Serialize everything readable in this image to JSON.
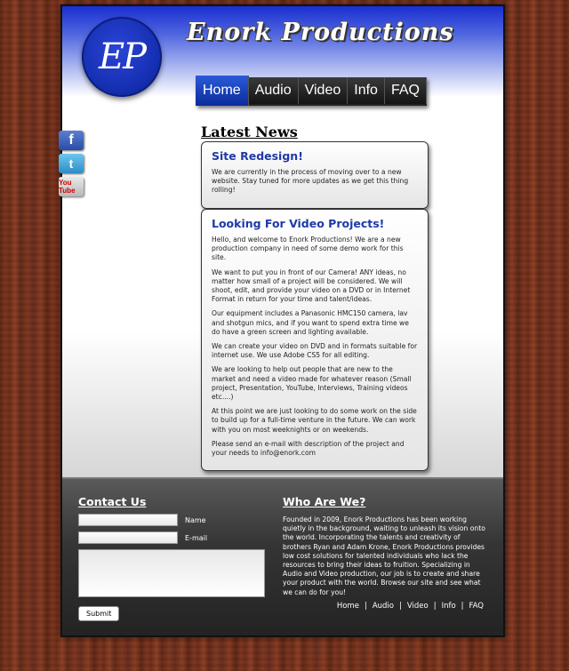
{
  "brand": {
    "logo_text": "EP",
    "title": "Enork Productions"
  },
  "nav": [
    {
      "label": "Home",
      "active": true
    },
    {
      "label": "Audio",
      "active": false
    },
    {
      "label": "Video",
      "active": false
    },
    {
      "label": "Info",
      "active": false
    },
    {
      "label": "FAQ",
      "active": false
    }
  ],
  "social": {
    "facebook": "f",
    "twitter": "t",
    "youtube": "You Tube"
  },
  "news": {
    "heading": "Latest News",
    "posts": [
      {
        "title": "Site Redesign!",
        "paragraphs": [
          "We are currently in the process of moving over to a new website. Stay tuned for more updates as we get this thing rolling!"
        ]
      },
      {
        "title": "Looking For Video Projects!",
        "paragraphs": [
          "Hello, and welcome to Enork Productions! We are a new production company in need of some demo work for this site.",
          "We want to put you in front of our Camera! ANY ideas, no matter how small of a project will be considered. We will shoot, edit, and provide your video on a DVD or in Internet Format in return for your time and talent/ideas.",
          "Our equipment includes a Panasonic HMC150 camera, lav and shotgun mics, and if you want to spend extra time we do have a green screen and lighting available.",
          "We can create your video on DVD and in formats suitable for internet use. We use Adobe CS5 for all editing.",
          "We are looking to help out people that are new to the market and need a video made for whatever reason (Small project, Presentation, YouTube, Interviews, Training videos etc....)",
          "At this point we are just looking to do some work on the side to build up for a full-time venture in the future. We can work with you on most weeknights or on weekends.",
          "Please send an e-mail with description of the project and your needs to info@enork.com"
        ]
      }
    ]
  },
  "contact": {
    "heading": "Contact Us",
    "name_label": "Name",
    "email_label": "E-mail",
    "name_value": "",
    "email_value": "",
    "message_value": "",
    "submit_label": "Submit"
  },
  "about": {
    "heading": "Who Are We?",
    "text": "Founded in 2009, Enork Productions has been working quietly in the background, waiting to unleash its vision onto the world. Incorporating the talents and creativity of brothers Ryan and Adam Krone, Enork Productions provides low cost solutions for talented individuals who lack the resources to bring their ideas to fruition. Specializing in Audio and Video production, our job is to create and share your product with the world. Browse our site and see what we can do for you!"
  },
  "footer_nav": [
    "Home",
    "Audio",
    "Video",
    "Info",
    "FAQ"
  ],
  "colors": {
    "accent_blue": "#1a2fd0",
    "title_blue": "#1e3aa8",
    "footer_dark": "#222222"
  }
}
